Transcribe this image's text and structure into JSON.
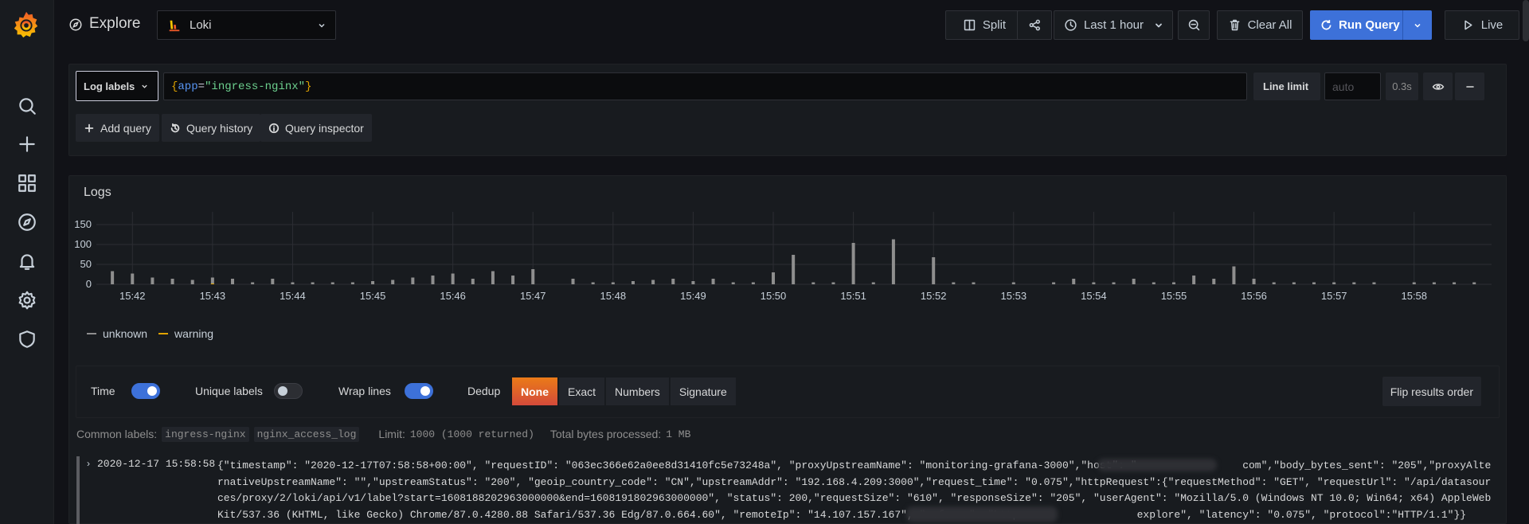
{
  "page": {
    "title": "Explore"
  },
  "datasource": {
    "name": "Loki"
  },
  "toolbar": {
    "split_label": "Split",
    "time_range_label": "Last 1 hour",
    "clear_all_label": "Clear All",
    "run_query_label": "Run Query",
    "live_label": "Live"
  },
  "query": {
    "log_labels_label": "Log labels",
    "expr_brace_open": "{",
    "expr_key": "app",
    "expr_eq": "=",
    "expr_value": "\"ingress-nginx\"",
    "expr_brace_close": "}",
    "line_limit_label": "Line limit",
    "line_limit_placeholder": "auto",
    "query_time": "0.3s",
    "add_query_label": "Add query",
    "query_history_label": "Query history",
    "query_inspector_label": "Query inspector"
  },
  "logs": {
    "title": "Logs",
    "legend": [
      {
        "name": "unknown",
        "color": "#8e8e8e"
      },
      {
        "name": "warning",
        "color": "#e0a300"
      }
    ],
    "options": {
      "time_label": "Time",
      "time_on": true,
      "unique_labels_label": "Unique labels",
      "unique_labels_on": false,
      "wrap_lines_label": "Wrap lines",
      "wrap_lines_on": true,
      "dedup_label": "Dedup",
      "dedup_options": [
        "None",
        "Exact",
        "Numbers",
        "Signature"
      ],
      "dedup_selected": "None",
      "flip_label": "Flip results order"
    },
    "meta": {
      "common_labels_label": "Common labels:",
      "common_labels": [
        "ingress-nginx",
        "nginx_access_log"
      ],
      "limit_label": "Limit:",
      "limit_value": "1000 (1000 returned)",
      "bytes_label": "Total bytes processed:",
      "bytes_value": "1 MB"
    },
    "rows": [
      {
        "timestamp": "2020-12-17 15:58:58",
        "line": "{\"timestamp\": \"2020-12-17T07:58:58+00:00\", \"requestID\": \"063ec366e62a0ee8d31410fc5e73248a\", \"proxyUpstreamName\": \"monitoring-grafana-3000\",\"host\": \"                 com\",\"body_bytes_sent\": \"205\",\"proxyAlternativeUpstreamName\": \"\",\"upstreamStatus\": \"200\", \"geoip_country_code\": \"CN\",\"upstreamAddr\": \"192.168.4.209:3000\",\"request_time\": \"0.075\",\"httpRequest\":{\"requestMethod\": \"GET\", \"requestUrl\": \"/api/datasources/proxy/2/loki/api/v1/label?start=1608188202963000000&end=1608191802963000000\", \"status\": 200,\"requestSize\": \"610\", \"responseSize\": \"205\", \"userAgent\": \"Mozilla/5.0 (Windows NT 10.0; Win64; x64) AppleWebKit/537.36 (KHTML, like Gecko) Chrome/87.0.4280.88 Safari/537.36 Edg/87.0.664.60\", \"remoteIp\": \"14.107.157.167\", \"referer\": \"http                   explore\", \"latency\": \"0.075\", \"protocol\":\"HTTP/1.1\"}}"
      }
    ]
  },
  "chart_data": {
    "type": "bar",
    "title": "",
    "ylim": [
      0,
      150
    ],
    "yticks": [
      0,
      50,
      100,
      150
    ],
    "xticks": [
      "15:42",
      "15:43",
      "15:44",
      "15:45",
      "15:46",
      "15:47",
      "15:48",
      "15:49",
      "15:50",
      "15:51",
      "15:52",
      "15:53",
      "15:54",
      "15:55",
      "15:56",
      "15:57",
      "15:58"
    ],
    "series": [
      {
        "name": "unknown",
        "color": "#8e8e8e",
        "x": [
          "15:41:45",
          "15:42:00",
          "15:42:15",
          "15:42:30",
          "15:42:45",
          "15:43:00",
          "15:43:15",
          "15:43:30",
          "15:43:45",
          "15:44:00",
          "15:44:15",
          "15:44:30",
          "15:44:45",
          "15:45:00",
          "15:45:15",
          "15:45:30",
          "15:45:45",
          "15:46:00",
          "15:46:15",
          "15:46:30",
          "15:46:45",
          "15:47:00",
          "15:47:30",
          "15:47:45",
          "15:48:00",
          "15:48:15",
          "15:48:30",
          "15:48:45",
          "15:49:00",
          "15:49:15",
          "15:49:30",
          "15:49:45",
          "15:50:00",
          "15:50:15",
          "15:50:30",
          "15:50:45",
          "15:51:00",
          "15:51:15",
          "15:51:30",
          "15:52:00",
          "15:52:15",
          "15:52:30",
          "15:53:00",
          "15:53:30",
          "15:53:45",
          "15:54:00",
          "15:54:15",
          "15:54:30",
          "15:54:45",
          "15:55:00",
          "15:55:15",
          "15:55:30",
          "15:55:45",
          "15:56:00",
          "15:56:15",
          "15:56:30",
          "15:56:45",
          "15:57:00",
          "15:57:15",
          "15:57:30",
          "15:58:00",
          "15:58:15",
          "15:58:30",
          "15:58:45"
        ],
        "values": [
          33,
          27,
          17,
          14,
          11,
          17,
          14,
          5,
          14,
          5,
          5,
          5,
          5,
          8,
          11,
          17,
          22,
          27,
          14,
          33,
          22,
          38,
          14,
          5,
          5,
          8,
          11,
          14,
          8,
          14,
          5,
          5,
          30,
          74,
          5,
          5,
          104,
          5,
          113,
          68,
          5,
          5,
          5,
          5,
          14,
          5,
          5,
          14,
          5,
          5,
          22,
          14,
          45,
          14,
          5,
          5,
          5,
          5,
          5,
          5,
          5,
          5,
          5,
          5
        ]
      },
      {
        "name": "warning",
        "color": "#e0a300",
        "x": [
          "15:43:00"
        ],
        "values": [
          2
        ]
      }
    ]
  }
}
